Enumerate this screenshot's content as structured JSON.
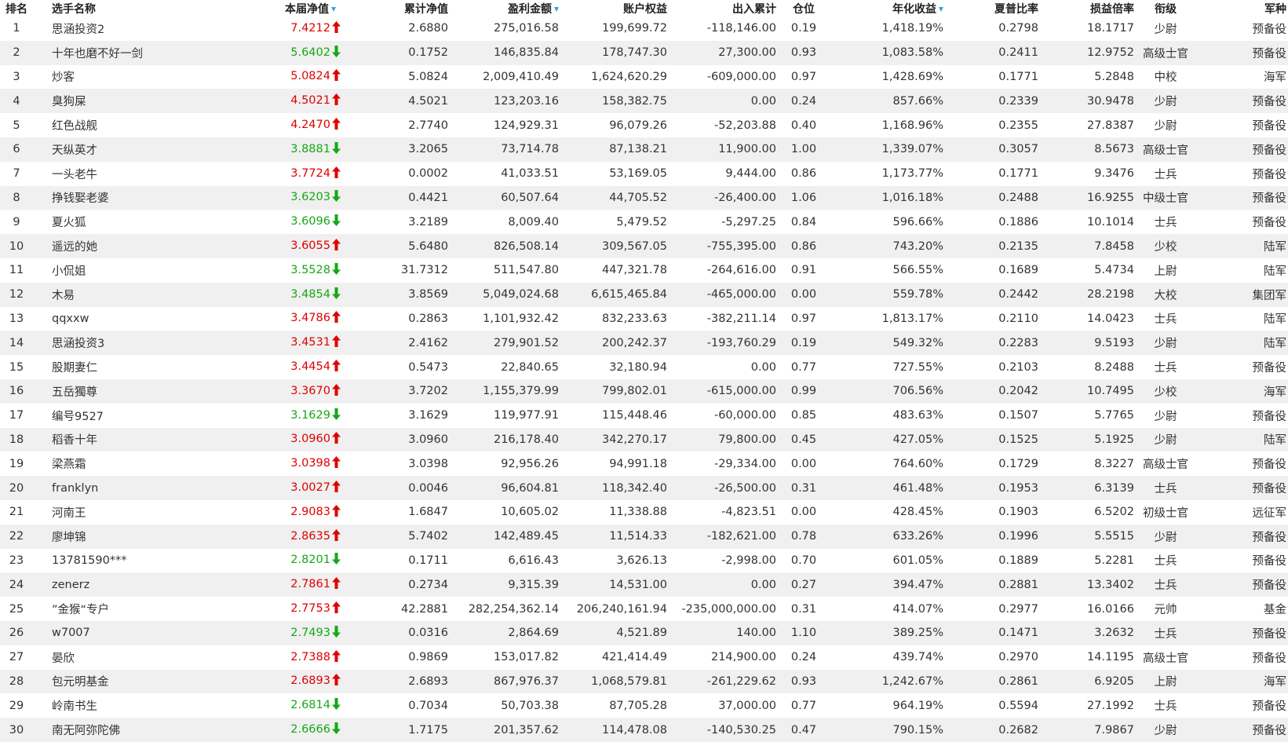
{
  "colors": {
    "up": "#e00000",
    "down": "#15a815",
    "sort": "#3a9fe0"
  },
  "headers": {
    "rank": "排名",
    "name": "选手名称",
    "nav": "本届净值",
    "cumulative": "累计净值",
    "profit": "盈利金额",
    "equity": "账户权益",
    "flow": "出入累计",
    "position": "仓位",
    "annualized": "年化收益",
    "sharpe": "夏普比率",
    "ratio": "损益倍率",
    "grade": "衔级",
    "type": "军种"
  },
  "rows": [
    {
      "rank": "1",
      "name": "思涵投资2",
      "nav": "7.4212",
      "dir": "up",
      "cumulative": "2.6880",
      "profit": "275,016.58",
      "equity": "199,699.72",
      "flow": "-118,146.00",
      "position": "0.19",
      "annualized": "1,418.19%",
      "sharpe": "0.2798",
      "ratio": "18.1717",
      "grade": "少尉",
      "type": "预备役"
    },
    {
      "rank": "2",
      "name": "十年也磨不好一剑",
      "nav": "5.6402",
      "dir": "down",
      "cumulative": "0.1752",
      "profit": "146,835.84",
      "equity": "178,747.30",
      "flow": "27,300.00",
      "position": "0.93",
      "annualized": "1,083.58%",
      "sharpe": "0.2411",
      "ratio": "12.9752",
      "grade": "高级士官",
      "type": "预备役"
    },
    {
      "rank": "3",
      "name": "炒客",
      "nav": "5.0824",
      "dir": "up",
      "cumulative": "5.0824",
      "profit": "2,009,410.49",
      "equity": "1,624,620.29",
      "flow": "-609,000.00",
      "position": "0.97",
      "annualized": "1,428.69%",
      "sharpe": "0.1771",
      "ratio": "5.2848",
      "grade": "中校",
      "type": "海军"
    },
    {
      "rank": "4",
      "name": "臭狗屎",
      "nav": "4.5021",
      "dir": "up",
      "cumulative": "4.5021",
      "profit": "123,203.16",
      "equity": "158,382.75",
      "flow": "0.00",
      "position": "0.24",
      "annualized": "857.66%",
      "sharpe": "0.2339",
      "ratio": "30.9478",
      "grade": "少尉",
      "type": "预备役"
    },
    {
      "rank": "5",
      "name": "红色战舰",
      "nav": "4.2470",
      "dir": "up",
      "cumulative": "2.7740",
      "profit": "124,929.31",
      "equity": "96,079.26",
      "flow": "-52,203.88",
      "position": "0.40",
      "annualized": "1,168.96%",
      "sharpe": "0.2355",
      "ratio": "27.8387",
      "grade": "少尉",
      "type": "预备役"
    },
    {
      "rank": "6",
      "name": "天纵英才",
      "nav": "3.8881",
      "dir": "down",
      "cumulative": "3.2065",
      "profit": "73,714.78",
      "equity": "87,138.21",
      "flow": "11,900.00",
      "position": "1.00",
      "annualized": "1,339.07%",
      "sharpe": "0.3057",
      "ratio": "8.5673",
      "grade": "高级士官",
      "type": "预备役"
    },
    {
      "rank": "7",
      "name": "一头老牛",
      "nav": "3.7724",
      "dir": "up",
      "cumulative": "0.0002",
      "profit": "41,033.51",
      "equity": "53,169.05",
      "flow": "9,444.00",
      "position": "0.86",
      "annualized": "1,173.77%",
      "sharpe": "0.1771",
      "ratio": "9.3476",
      "grade": "士兵",
      "type": "预备役"
    },
    {
      "rank": "8",
      "name": "挣钱娶老婆",
      "nav": "3.6203",
      "dir": "down",
      "cumulative": "0.4421",
      "profit": "60,507.64",
      "equity": "44,705.52",
      "flow": "-26,400.00",
      "position": "1.06",
      "annualized": "1,016.18%",
      "sharpe": "0.2488",
      "ratio": "16.9255",
      "grade": "中级士官",
      "type": "预备役"
    },
    {
      "rank": "9",
      "name": "夏火狐",
      "nav": "3.6096",
      "dir": "down",
      "cumulative": "3.2189",
      "profit": "8,009.40",
      "equity": "5,479.52",
      "flow": "-5,297.25",
      "position": "0.84",
      "annualized": "596.66%",
      "sharpe": "0.1886",
      "ratio": "10.1014",
      "grade": "士兵",
      "type": "预备役"
    },
    {
      "rank": "10",
      "name": "遥远的她",
      "nav": "3.6055",
      "dir": "up",
      "cumulative": "5.6480",
      "profit": "826,508.14",
      "equity": "309,567.05",
      "flow": "-755,395.00",
      "position": "0.86",
      "annualized": "743.20%",
      "sharpe": "0.2135",
      "ratio": "7.8458",
      "grade": "少校",
      "type": "陆军"
    },
    {
      "rank": "11",
      "name": "小侃姐",
      "nav": "3.5528",
      "dir": "down",
      "cumulative": "31.7312",
      "profit": "511,547.80",
      "equity": "447,321.78",
      "flow": "-264,616.00",
      "position": "0.91",
      "annualized": "566.55%",
      "sharpe": "0.1689",
      "ratio": "5.4734",
      "grade": "上尉",
      "type": "陆军"
    },
    {
      "rank": "12",
      "name": "木易",
      "nav": "3.4854",
      "dir": "down",
      "cumulative": "3.8569",
      "profit": "5,049,024.68",
      "equity": "6,615,465.84",
      "flow": "-465,000.00",
      "position": "0.00",
      "annualized": "559.78%",
      "sharpe": "0.2442",
      "ratio": "28.2198",
      "grade": "大校",
      "type": "集团军"
    },
    {
      "rank": "13",
      "name": "qqxxw",
      "nav": "3.4786",
      "dir": "up",
      "cumulative": "0.2863",
      "profit": "1,101,932.42",
      "equity": "832,233.63",
      "flow": "-382,211.14",
      "position": "0.97",
      "annualized": "1,813.17%",
      "sharpe": "0.2110",
      "ratio": "14.0423",
      "grade": "士兵",
      "type": "陆军"
    },
    {
      "rank": "14",
      "name": "思涵投资3",
      "nav": "3.4531",
      "dir": "up",
      "cumulative": "2.4162",
      "profit": "279,901.52",
      "equity": "200,242.37",
      "flow": "-193,760.29",
      "position": "0.19",
      "annualized": "549.32%",
      "sharpe": "0.2283",
      "ratio": "9.5193",
      "grade": "少尉",
      "type": "陆军"
    },
    {
      "rank": "15",
      "name": "股期妻仁",
      "nav": "3.4454",
      "dir": "up",
      "cumulative": "0.5473",
      "profit": "22,840.65",
      "equity": "32,180.94",
      "flow": "0.00",
      "position": "0.77",
      "annualized": "727.55%",
      "sharpe": "0.2103",
      "ratio": "8.2488",
      "grade": "士兵",
      "type": "预备役"
    },
    {
      "rank": "16",
      "name": "五岳獨尊",
      "nav": "3.3670",
      "dir": "up",
      "cumulative": "3.7202",
      "profit": "1,155,379.99",
      "equity": "799,802.01",
      "flow": "-615,000.00",
      "position": "0.99",
      "annualized": "706.56%",
      "sharpe": "0.2042",
      "ratio": "10.7495",
      "grade": "少校",
      "type": "海军"
    },
    {
      "rank": "17",
      "name": "编号9527",
      "nav": "3.1629",
      "dir": "down",
      "cumulative": "3.1629",
      "profit": "119,977.91",
      "equity": "115,448.46",
      "flow": "-60,000.00",
      "position": "0.85",
      "annualized": "483.63%",
      "sharpe": "0.1507",
      "ratio": "5.7765",
      "grade": "少尉",
      "type": "预备役"
    },
    {
      "rank": "18",
      "name": "稻香十年",
      "nav": "3.0960",
      "dir": "up",
      "cumulative": "3.0960",
      "profit": "216,178.40",
      "equity": "342,270.17",
      "flow": "79,800.00",
      "position": "0.45",
      "annualized": "427.05%",
      "sharpe": "0.1525",
      "ratio": "5.1925",
      "grade": "少尉",
      "type": "陆军"
    },
    {
      "rank": "19",
      "name": "梁燕霜",
      "nav": "3.0398",
      "dir": "up",
      "cumulative": "3.0398",
      "profit": "92,956.26",
      "equity": "94,991.18",
      "flow": "-29,334.00",
      "position": "0.00",
      "annualized": "764.60%",
      "sharpe": "0.1729",
      "ratio": "8.3227",
      "grade": "高级士官",
      "type": "预备役"
    },
    {
      "rank": "20",
      "name": "franklyn",
      "nav": "3.0027",
      "dir": "up",
      "cumulative": "0.0046",
      "profit": "96,604.81",
      "equity": "118,342.40",
      "flow": "-26,500.00",
      "position": "0.31",
      "annualized": "461.48%",
      "sharpe": "0.1953",
      "ratio": "6.3139",
      "grade": "士兵",
      "type": "预备役"
    },
    {
      "rank": "21",
      "name": "河南王",
      "nav": "2.9083",
      "dir": "up",
      "cumulative": "1.6847",
      "profit": "10,605.02",
      "equity": "11,338.88",
      "flow": "-4,823.51",
      "position": "0.00",
      "annualized": "428.45%",
      "sharpe": "0.1903",
      "ratio": "6.5202",
      "grade": "初级士官",
      "type": "远征军"
    },
    {
      "rank": "22",
      "name": "廖坤锦",
      "nav": "2.8635",
      "dir": "up",
      "cumulative": "5.7402",
      "profit": "142,489.45",
      "equity": "11,514.33",
      "flow": "-182,621.00",
      "position": "0.78",
      "annualized": "633.26%",
      "sharpe": "0.1996",
      "ratio": "5.5515",
      "grade": "少尉",
      "type": "预备役"
    },
    {
      "rank": "23",
      "name": "13781590***",
      "nav": "2.8201",
      "dir": "down",
      "cumulative": "0.1711",
      "profit": "6,616.43",
      "equity": "3,626.13",
      "flow": "-2,998.00",
      "position": "0.70",
      "annualized": "601.05%",
      "sharpe": "0.1889",
      "ratio": "5.2281",
      "grade": "士兵",
      "type": "预备役"
    },
    {
      "rank": "24",
      "name": "zenerz",
      "nav": "2.7861",
      "dir": "up",
      "cumulative": "0.2734",
      "profit": "9,315.39",
      "equity": "14,531.00",
      "flow": "0.00",
      "position": "0.27",
      "annualized": "394.47%",
      "sharpe": "0.2881",
      "ratio": "13.3402",
      "grade": "士兵",
      "type": "预备役"
    },
    {
      "rank": "25",
      "name": "”金猴“专户",
      "nav": "2.7753",
      "dir": "up",
      "cumulative": "42.2881",
      "profit": "282,254,362.14",
      "equity": "206,240,161.94",
      "flow": "-235,000,000.00",
      "position": "0.31",
      "annualized": "414.07%",
      "sharpe": "0.2977",
      "ratio": "16.0166",
      "grade": "元帅",
      "type": "基金"
    },
    {
      "rank": "26",
      "name": "w7007",
      "nav": "2.7493",
      "dir": "down",
      "cumulative": "0.0316",
      "profit": "2,864.69",
      "equity": "4,521.89",
      "flow": "140.00",
      "position": "1.10",
      "annualized": "389.25%",
      "sharpe": "0.1471",
      "ratio": "3.2632",
      "grade": "士兵",
      "type": "预备役"
    },
    {
      "rank": "27",
      "name": "晏欣",
      "nav": "2.7388",
      "dir": "up",
      "cumulative": "0.9869",
      "profit": "153,017.82",
      "equity": "421,414.49",
      "flow": "214,900.00",
      "position": "0.24",
      "annualized": "439.74%",
      "sharpe": "0.2970",
      "ratio": "14.1195",
      "grade": "高级士官",
      "type": "预备役"
    },
    {
      "rank": "28",
      "name": "包元明基金",
      "nav": "2.6893",
      "dir": "up",
      "cumulative": "2.6893",
      "profit": "867,976.37",
      "equity": "1,068,579.81",
      "flow": "-261,229.62",
      "position": "0.93",
      "annualized": "1,242.67%",
      "sharpe": "0.2861",
      "ratio": "6.9205",
      "grade": "上尉",
      "type": "海军"
    },
    {
      "rank": "29",
      "name": "岭南书生",
      "nav": "2.6814",
      "dir": "down",
      "cumulative": "0.7034",
      "profit": "50,703.38",
      "equity": "87,705.28",
      "flow": "37,000.00",
      "position": "0.77",
      "annualized": "964.19%",
      "sharpe": "0.5594",
      "ratio": "27.1992",
      "grade": "士兵",
      "type": "预备役"
    },
    {
      "rank": "30",
      "name": "南无阿弥陀佛",
      "nav": "2.6666",
      "dir": "down",
      "cumulative": "1.7175",
      "profit": "201,357.62",
      "equity": "114,478.08",
      "flow": "-140,530.25",
      "position": "0.47",
      "annualized": "790.15%",
      "sharpe": "0.2682",
      "ratio": "7.9867",
      "grade": "少尉",
      "type": "预备役"
    }
  ]
}
